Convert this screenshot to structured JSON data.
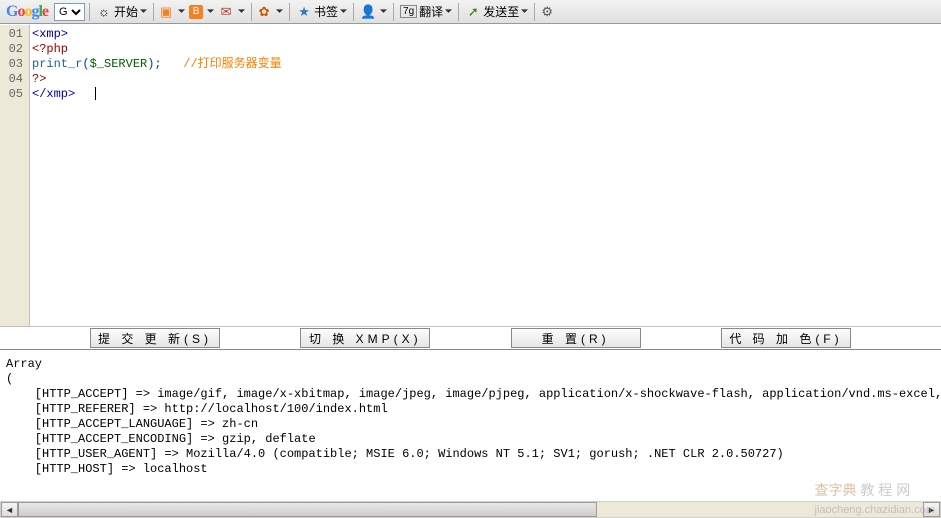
{
  "toolbar": {
    "google": "Google",
    "g_select": "G",
    "start": "开始",
    "bookmarks": "书签",
    "login": "",
    "translate_badge": "7g",
    "translate": "翻译",
    "send": "发送至"
  },
  "editor": {
    "lines": [
      "01",
      "02",
      "03",
      "04",
      "05"
    ],
    "l1_tag": "<xmp>",
    "l2_php": "<?php",
    "l3_func": "print_r",
    "l3_p1": "(",
    "l3_var": "$_SERVER",
    "l3_p2": ");",
    "l3_com": "//打印服务器变量",
    "l4_php": "?>",
    "l5_tag": "</xmp>"
  },
  "buttons": {
    "submit": "提 交 更 新(S)",
    "toggle": "切 换 XMP(X)",
    "reset": "重 置(R)",
    "color": "代 码 加 色(F)"
  },
  "output": {
    "text": "Array\n(\n    [HTTP_ACCEPT] => image/gif, image/x-xbitmap, image/jpeg, image/pjpeg, application/x-shockwave-flash, application/vnd.ms-excel, app\n    [HTTP_REFERER] => http://localhost/100/index.html\n    [HTTP_ACCEPT_LANGUAGE] => zh-cn\n    [HTTP_ACCEPT_ENCODING] => gzip, deflate\n    [HTTP_USER_AGENT] => Mozilla/4.0 (compatible; MSIE 6.0; Windows NT 5.1; SV1; gorush; .NET CLR 2.0.50727)\n    [HTTP_HOST] => localhost"
  },
  "watermark": {
    "a": "查字典",
    "b": "教 程 网",
    "c": "jiaocheng.chazidian.com"
  }
}
